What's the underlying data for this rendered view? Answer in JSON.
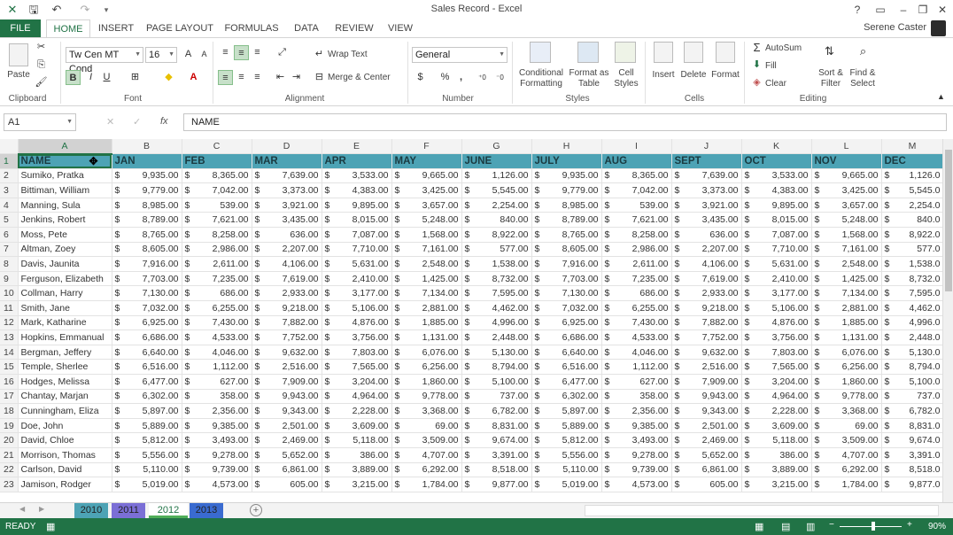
{
  "window": {
    "title": "Sales Record - Excel",
    "user": "Serene Caster",
    "help": "?"
  },
  "tabs": [
    {
      "label": "FILE"
    },
    {
      "label": "HOME"
    },
    {
      "label": "INSERT"
    },
    {
      "label": "PAGE LAYOUT"
    },
    {
      "label": "FORMULAS"
    },
    {
      "label": "DATA"
    },
    {
      "label": "REVIEW"
    },
    {
      "label": "VIEW"
    }
  ],
  "ribbon": {
    "clipboard": {
      "label": "Clipboard",
      "paste": "Paste"
    },
    "font": {
      "label": "Font",
      "name": "Tw Cen MT Cond",
      "size": "16",
      "bold": "B",
      "italic": "I",
      "underline": "U"
    },
    "alignment": {
      "label": "Alignment",
      "wrap": "Wrap Text",
      "merge": "Merge & Center"
    },
    "number": {
      "label": "Number",
      "format": "General",
      "currency": "$",
      "percent": "%",
      "comma": ","
    },
    "styles": {
      "label": "Styles",
      "cond1": "Conditional",
      "cond2": "Formatting",
      "fat1": "Format as",
      "fat2": "Table",
      "cell1": "Cell",
      "cell2": "Styles"
    },
    "cells": {
      "label": "Cells",
      "insert": "Insert",
      "delete": "Delete",
      "format": "Format"
    },
    "editing": {
      "label": "Editing",
      "autosum": "AutoSum",
      "fill": "Fill",
      "clear": "Clear",
      "sort1": "Sort &",
      "sort2": "Filter",
      "find1": "Find &",
      "find2": "Select"
    }
  },
  "formula_bar": {
    "name_box": "A1",
    "fx": "fx",
    "content": "NAME"
  },
  "columns": [
    "A",
    "B",
    "C",
    "D",
    "E",
    "F",
    "G",
    "H",
    "I",
    "J",
    "K",
    "L",
    "M"
  ],
  "header_row": [
    "NAME",
    "JAN",
    "FEB",
    "MAR",
    "APR",
    "MAY",
    "JUNE",
    "JULY",
    "AUG",
    "SEPT",
    "OCT",
    "NOV",
    "DEC"
  ],
  "rows": [
    {
      "n": "2",
      "name": "Sumiko, Pratka",
      "v": [
        "9,935.00",
        "8,365.00",
        "7,639.00",
        "3,533.00",
        "9,665.00",
        "1,126.00",
        "9,935.00",
        "8,365.00",
        "7,639.00",
        "3,533.00",
        "9,665.00",
        "1,126.0"
      ]
    },
    {
      "n": "3",
      "name": "Bittiman, William",
      "v": [
        "9,779.00",
        "7,042.00",
        "3,373.00",
        "4,383.00",
        "3,425.00",
        "5,545.00",
        "9,779.00",
        "7,042.00",
        "3,373.00",
        "4,383.00",
        "3,425.00",
        "5,545.0"
      ]
    },
    {
      "n": "4",
      "name": "Manning, Sula",
      "v": [
        "8,985.00",
        "539.00",
        "3,921.00",
        "9,895.00",
        "3,657.00",
        "2,254.00",
        "8,985.00",
        "539.00",
        "3,921.00",
        "9,895.00",
        "3,657.00",
        "2,254.0"
      ]
    },
    {
      "n": "5",
      "name": "Jenkins, Robert",
      "v": [
        "8,789.00",
        "7,621.00",
        "3,435.00",
        "8,015.00",
        "5,248.00",
        "840.00",
        "8,789.00",
        "7,621.00",
        "3,435.00",
        "8,015.00",
        "5,248.00",
        "840.0"
      ]
    },
    {
      "n": "6",
      "name": "Moss, Pete",
      "v": [
        "8,765.00",
        "8,258.00",
        "636.00",
        "7,087.00",
        "1,568.00",
        "8,922.00",
        "8,765.00",
        "8,258.00",
        "636.00",
        "7,087.00",
        "1,568.00",
        "8,922.0"
      ]
    },
    {
      "n": "7",
      "name": "Altman, Zoey",
      "v": [
        "8,605.00",
        "2,986.00",
        "2,207.00",
        "7,710.00",
        "7,161.00",
        "577.00",
        "8,605.00",
        "2,986.00",
        "2,207.00",
        "7,710.00",
        "7,161.00",
        "577.0"
      ]
    },
    {
      "n": "8",
      "name": "Davis, Jaunita",
      "v": [
        "7,916.00",
        "2,611.00",
        "4,106.00",
        "5,631.00",
        "2,548.00",
        "1,538.00",
        "7,916.00",
        "2,611.00",
        "4,106.00",
        "5,631.00",
        "2,548.00",
        "1,538.0"
      ]
    },
    {
      "n": "9",
      "name": "Ferguson, Elizabeth",
      "v": [
        "7,703.00",
        "7,235.00",
        "7,619.00",
        "2,410.00",
        "1,425.00",
        "8,732.00",
        "7,703.00",
        "7,235.00",
        "7,619.00",
        "2,410.00",
        "1,425.00",
        "8,732.0"
      ]
    },
    {
      "n": "10",
      "name": "Collman, Harry",
      "v": [
        "7,130.00",
        "686.00",
        "2,933.00",
        "3,177.00",
        "7,134.00",
        "7,595.00",
        "7,130.00",
        "686.00",
        "2,933.00",
        "3,177.00",
        "7,134.00",
        "7,595.0"
      ]
    },
    {
      "n": "11",
      "name": "Smith, Jane",
      "v": [
        "7,032.00",
        "6,255.00",
        "9,218.00",
        "5,106.00",
        "2,881.00",
        "4,462.00",
        "7,032.00",
        "6,255.00",
        "9,218.00",
        "5,106.00",
        "2,881.00",
        "4,462.0"
      ]
    },
    {
      "n": "12",
      "name": "Mark, Katharine",
      "v": [
        "6,925.00",
        "7,430.00",
        "7,882.00",
        "4,876.00",
        "1,885.00",
        "4,996.00",
        "6,925.00",
        "7,430.00",
        "7,882.00",
        "4,876.00",
        "1,885.00",
        "4,996.0"
      ]
    },
    {
      "n": "13",
      "name": "Hopkins, Emmanual",
      "v": [
        "6,686.00",
        "4,533.00",
        "7,752.00",
        "3,756.00",
        "1,131.00",
        "2,448.00",
        "6,686.00",
        "4,533.00",
        "7,752.00",
        "3,756.00",
        "1,131.00",
        "2,448.0"
      ]
    },
    {
      "n": "14",
      "name": "Bergman, Jeffery",
      "v": [
        "6,640.00",
        "4,046.00",
        "9,632.00",
        "7,803.00",
        "6,076.00",
        "5,130.00",
        "6,640.00",
        "4,046.00",
        "9,632.00",
        "7,803.00",
        "6,076.00",
        "5,130.0"
      ]
    },
    {
      "n": "15",
      "name": "Temple, Sherlee",
      "v": [
        "6,516.00",
        "1,112.00",
        "2,516.00",
        "7,565.00",
        "6,256.00",
        "8,794.00",
        "6,516.00",
        "1,112.00",
        "2,516.00",
        "7,565.00",
        "6,256.00",
        "8,794.0"
      ]
    },
    {
      "n": "16",
      "name": "Hodges, Melissa",
      "v": [
        "6,477.00",
        "627.00",
        "7,909.00",
        "3,204.00",
        "1,860.00",
        "5,100.00",
        "6,477.00",
        "627.00",
        "7,909.00",
        "3,204.00",
        "1,860.00",
        "5,100.0"
      ]
    },
    {
      "n": "17",
      "name": "Chantay, Marjan",
      "v": [
        "6,302.00",
        "358.00",
        "9,943.00",
        "4,964.00",
        "9,778.00",
        "737.00",
        "6,302.00",
        "358.00",
        "9,943.00",
        "4,964.00",
        "9,778.00",
        "737.0"
      ]
    },
    {
      "n": "18",
      "name": "Cunningham, Eliza",
      "v": [
        "5,897.00",
        "2,356.00",
        "9,343.00",
        "2,228.00",
        "3,368.00",
        "6,782.00",
        "5,897.00",
        "2,356.00",
        "9,343.00",
        "2,228.00",
        "3,368.00",
        "6,782.0"
      ]
    },
    {
      "n": "19",
      "name": "Doe, John",
      "v": [
        "5,889.00",
        "9,385.00",
        "2,501.00",
        "3,609.00",
        "69.00",
        "8,831.00",
        "5,889.00",
        "9,385.00",
        "2,501.00",
        "3,609.00",
        "69.00",
        "8,831.0"
      ]
    },
    {
      "n": "20",
      "name": "David, Chloe",
      "v": [
        "5,812.00",
        "3,493.00",
        "2,469.00",
        "5,118.00",
        "3,509.00",
        "9,674.00",
        "5,812.00",
        "3,493.00",
        "2,469.00",
        "5,118.00",
        "3,509.00",
        "9,674.0"
      ]
    },
    {
      "n": "21",
      "name": "Morrison, Thomas",
      "v": [
        "5,556.00",
        "9,278.00",
        "5,652.00",
        "386.00",
        "4,707.00",
        "3,391.00",
        "5,556.00",
        "9,278.00",
        "5,652.00",
        "386.00",
        "4,707.00",
        "3,391.0"
      ]
    },
    {
      "n": "22",
      "name": "Carlson, David",
      "v": [
        "5,110.00",
        "9,739.00",
        "6,861.00",
        "3,889.00",
        "6,292.00",
        "8,518.00",
        "5,110.00",
        "9,739.00",
        "6,861.00",
        "3,889.00",
        "6,292.00",
        "8,518.0"
      ]
    },
    {
      "n": "23",
      "name": "Jamison, Rodger",
      "v": [
        "5,019.00",
        "4,573.00",
        "605.00",
        "3,215.00",
        "1,784.00",
        "9,877.00",
        "5,019.00",
        "4,573.00",
        "605.00",
        "3,215.00",
        "1,784.00",
        "9,877.0"
      ]
    }
  ],
  "currency_symbol": "$",
  "sheets": [
    {
      "label": "2010",
      "color": "#4da3b5"
    },
    {
      "label": "2011",
      "color": "#7b6fd6"
    },
    {
      "label": "2012",
      "color": "#4fae58"
    },
    {
      "label": "2013",
      "color": "#3a6bd0"
    }
  ],
  "status": {
    "ready": "READY",
    "zoom": "90%"
  },
  "colors": {
    "accent": "#217346",
    "header_fill": "#4da3b5"
  }
}
